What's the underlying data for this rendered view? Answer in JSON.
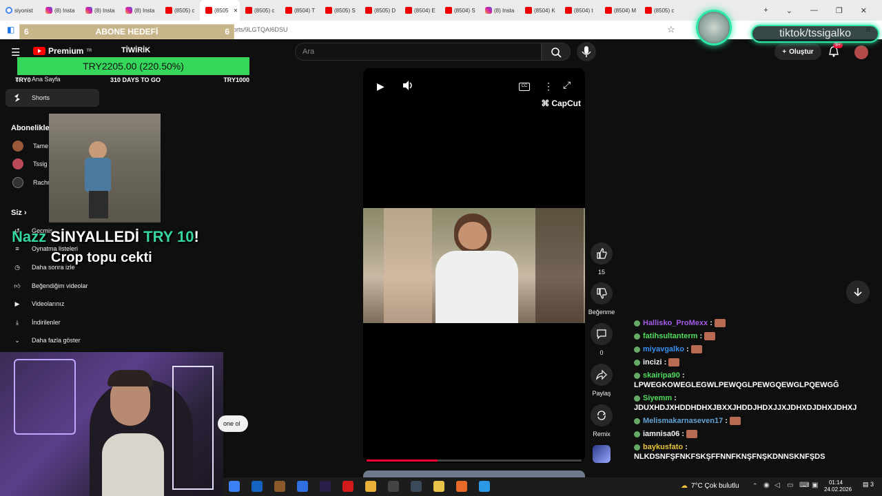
{
  "browser": {
    "tabs": [
      {
        "label": "siyonist",
        "icon": "google"
      },
      {
        "label": "(8) Insta",
        "icon": "instagram"
      },
      {
        "label": "(8) Insta",
        "icon": "instagram"
      },
      {
        "label": "(8) Insta",
        "icon": "instagram"
      },
      {
        "label": "(8505) c",
        "icon": "youtube"
      },
      {
        "label": "(8505",
        "icon": "youtube",
        "active": true
      },
      {
        "label": "(8505) c",
        "icon": "youtube"
      },
      {
        "label": "(8504) T",
        "icon": "youtube"
      },
      {
        "label": "(8505) S",
        "icon": "youtube"
      },
      {
        "label": "(8505) D",
        "icon": "youtube"
      },
      {
        "label": "(8504) E",
        "icon": "youtube"
      },
      {
        "label": "(8504) S",
        "icon": "youtube"
      },
      {
        "label": "(8) Insta",
        "icon": "instagram"
      },
      {
        "label": "(8504) K",
        "icon": "youtube"
      },
      {
        "label": "(8504) t",
        "icon": "youtube"
      },
      {
        "label": "(8504) M",
        "icon": "youtube"
      },
      {
        "label": "(8505) c",
        "icon": "youtube"
      }
    ],
    "url": "orts/9LGTQAI6DSU"
  },
  "youtube": {
    "premium_label": "Premium",
    "region": "TR",
    "search_placeholder": "Ara",
    "create_label": "Oluştur",
    "notif_count": "9+"
  },
  "sidebar": {
    "home_label": "Ana Sayfa",
    "shorts_label": "Shorts",
    "subscriptions_heading": "Abonelikler",
    "channels": [
      {
        "label": "Tame"
      },
      {
        "label": "Tssig"
      },
      {
        "label": "Rachr"
      }
    ],
    "you_heading": "Siz",
    "you_items": [
      {
        "label": "Geçmiş",
        "icon": "history-icon"
      },
      {
        "label": "Oynatma listeleri",
        "icon": "playlist-icon"
      },
      {
        "label": "Daha sonra izle",
        "icon": "clock-icon"
      },
      {
        "label": "Beğendiğim videolar",
        "icon": "thumb-up-icon"
      },
      {
        "label": "Videolarınız",
        "icon": "video-icon"
      },
      {
        "label": "İndirilenler",
        "icon": "download-icon"
      },
      {
        "label": "Daha fazla göster",
        "icon": "chevron-down-icon"
      }
    ]
  },
  "overlays": {
    "sub_goal": {
      "left": "6",
      "title": "ABONE HEDEFİ",
      "right": "6"
    },
    "tiwirik": "TİWİRİK",
    "donation": {
      "amount": "TRY2205.00 (220.50%)",
      "start": "TRY0",
      "days": "310 DAYS TO GO",
      "target": "TRY1000"
    },
    "alert": {
      "user": "Nazz",
      "action": "SİNYALLEDİ",
      "amount": "TRY 10",
      "bang": "!",
      "message": "Crop topu cekti"
    },
    "subscribe_pill": "one ol",
    "tiktok_handle": "tiktok/tssigalko"
  },
  "player": {
    "watermark": "CapCut",
    "progress": 0.33
  },
  "actions": {
    "likes": "15",
    "dislike_label": "Beğenme",
    "comments": "0",
    "share_label": "Paylaş",
    "remix_label": "Remix"
  },
  "chat": [
    {
      "user": "Hallisko_ProMexx",
      "color": "#a45ce6",
      "text": "",
      "emote": true
    },
    {
      "user": "fatihsultanterm",
      "color": "#4fdc5a",
      "text": "",
      "emote": true
    },
    {
      "user": "miyavgalko",
      "color": "#3a8ff0",
      "text": "",
      "emote": true
    },
    {
      "user": "incizi",
      "color": "#f1f1f1",
      "text": "",
      "emote": true
    },
    {
      "user": "skairipa90",
      "color": "#4fdc5a",
      "text": "LPWEGKOWEGLEGWLPEWQGLPEWGQEWGLPQEWGĞ",
      "emote": false
    },
    {
      "user": "Siyemm",
      "color": "#4fdc5a",
      "text": "JDUXHDJXHDDHDHXJBXXJHDDJHDXJJXJDHXDJDHXJDHXJ",
      "emote": false
    },
    {
      "user": "Melismakarnaseven17",
      "color": "#62a3d6",
      "text": "",
      "emote": true
    },
    {
      "user": "iamnisa06",
      "color": "#f1f1f1",
      "text": "",
      "emote": true
    },
    {
      "user": "baykusfato",
      "color": "#e8c63a",
      "text": "NLKDSNFŞFNKFSKŞFFNNFKNŞFNŞKDNNSKNFŞDS",
      "emote": false
    }
  ],
  "taskbar": {
    "weather": "7°C  Çok bulutlu",
    "time": "01:14",
    "date": "24.02.2026",
    "notif": "3"
  },
  "colors": {
    "accent_green": "#36d65a",
    "tiktok_glow": "#2fe8a8",
    "yt_red": "#ff0000"
  }
}
